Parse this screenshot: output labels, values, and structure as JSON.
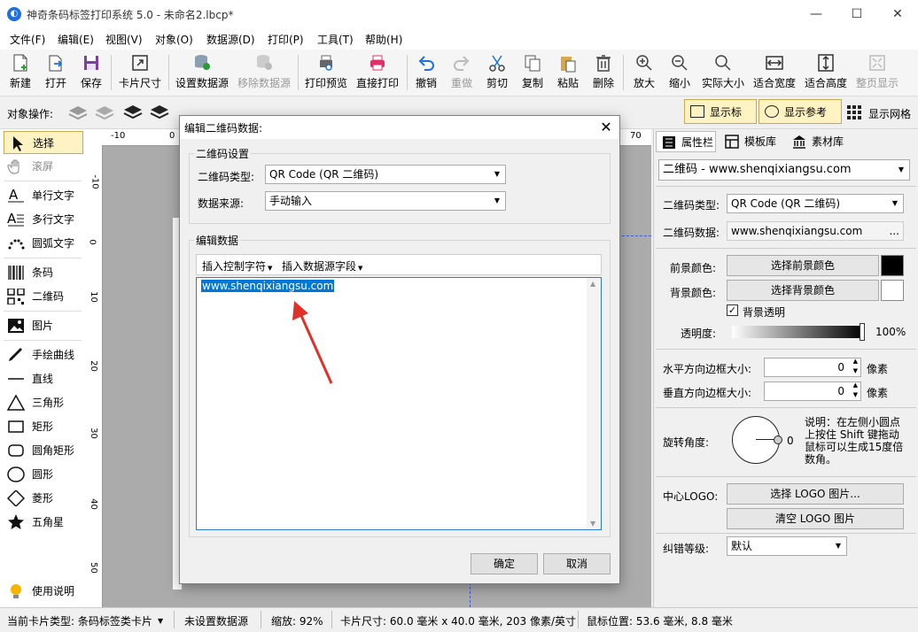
{
  "window": {
    "title": "神奇条码标签打印系统 5.0 - 未命名2.lbcp*",
    "controls": [
      "—",
      "☐",
      "✕"
    ]
  },
  "menu": [
    "文件(F)",
    "编辑(E)",
    "视图(V)",
    "对象(O)",
    "数据源(D)",
    "打印(P)",
    "工具(T)",
    "帮助(H)"
  ],
  "toolbar": {
    "new": "新建",
    "open": "打开",
    "save": "保存",
    "card_size": "卡片尺寸",
    "set_datasource": "设置数据源",
    "remove_datasource": "移除数据源",
    "print_preview": "打印预览",
    "direct_print": "直接打印",
    "undo": "撤销",
    "redo": "重做",
    "cut": "剪切",
    "copy": "复制",
    "paste": "粘贴",
    "delete": "删除",
    "zoom_in": "放大",
    "zoom_out": "缩小",
    "actual_size": "实际大小",
    "fit_width": "适合宽度",
    "fit_height": "适合高度",
    "full_page": "整页显示"
  },
  "objbar": {
    "label": "对象操作:",
    "show_ruler": "显示标尺",
    "show_guides": "显示参考线",
    "show_grid": "显示网格"
  },
  "tools": [
    {
      "label": "选择"
    },
    {
      "label": "滚屏"
    },
    {
      "label": "单行文字"
    },
    {
      "label": "多行文字"
    },
    {
      "label": "圆弧文字"
    },
    {
      "label": "条码"
    },
    {
      "label": "二维码"
    },
    {
      "label": "图片"
    },
    {
      "label": "手绘曲线"
    },
    {
      "label": "直线"
    },
    {
      "label": "三角形"
    },
    {
      "label": "矩形"
    },
    {
      "label": "圆角矩形"
    },
    {
      "label": "圆形"
    },
    {
      "label": "菱形"
    },
    {
      "label": "五角星"
    },
    {
      "label": "使用说明"
    }
  ],
  "rulers": {
    "top": [
      "-10",
      "0",
      "70"
    ],
    "left": [
      "-10",
      "0",
      "10",
      "20",
      "30",
      "40",
      "50"
    ]
  },
  "right_panel": {
    "tabs": [
      "属性栏",
      "模板库",
      "素材库"
    ],
    "object_selector": "二维码 - www.shenqixiangsu.com",
    "qr_type_label": "二维码类型:",
    "qr_type_value": "QR Code (QR 二维码)",
    "qr_data_label": "二维码数据:",
    "qr_data_value": "www.shenqixiangsu.com",
    "qr_data_more": "...",
    "fg_color_label": "前景颜色:",
    "fg_color_button": "选择前景颜色",
    "fg_color": "#000000",
    "bg_color_label": "背景颜色:",
    "bg_color_button": "选择背景颜色",
    "bg_color": "#ffffff",
    "bg_transparent_label": "背景透明",
    "bg_transparent_checked": true,
    "opacity_label": "透明度:",
    "opacity_value": "100%",
    "h_border_label": "水平方向边框大小:",
    "h_border_value": "0",
    "v_border_label": "垂直方向边框大小:",
    "v_border_value": "0",
    "border_unit": "像素",
    "rotation_label": "旋转角度:",
    "rotation_value": "0",
    "rotation_note": "说明：在左侧小圆点上按住 Shift 键拖动鼠标可以生成15度倍数角。",
    "logo_label": "中心LOGO:",
    "logo_select_button": "选择 LOGO 图片...",
    "logo_clear_button": "清空  LOGO 图片",
    "ecc_label": "纠错等级:",
    "ecc_value": "默认"
  },
  "status": {
    "card_type": "当前卡片类型: 条码标签类卡片",
    "datasource": "未设置数据源",
    "zoom": "缩放: 92%",
    "card_size": "卡片尺寸: 60.0 毫米 x 40.0 毫米, 203 像素/英寸",
    "mouse_pos": "鼠标位置: 53.6 毫米, 8.8 毫米"
  },
  "dialog": {
    "title": "编辑二维码数据:",
    "settings_group": "二维码设置",
    "qr_type_label": "二维码类型:",
    "qr_type_value": "QR Code (QR 二维码)",
    "source_label": "数据来源:",
    "source_value": "手动输入",
    "edit_group": "编辑数据",
    "insert_control": "插入控制字符",
    "insert_field": "插入数据源字段",
    "data_text": "www.shenqixiangsu.com",
    "ok": "确定",
    "cancel": "取消"
  },
  "colors": {
    "accent": "#0078d7",
    "toggle_active": "#fff3c4",
    "annotation_arrow": "#e0302a"
  }
}
